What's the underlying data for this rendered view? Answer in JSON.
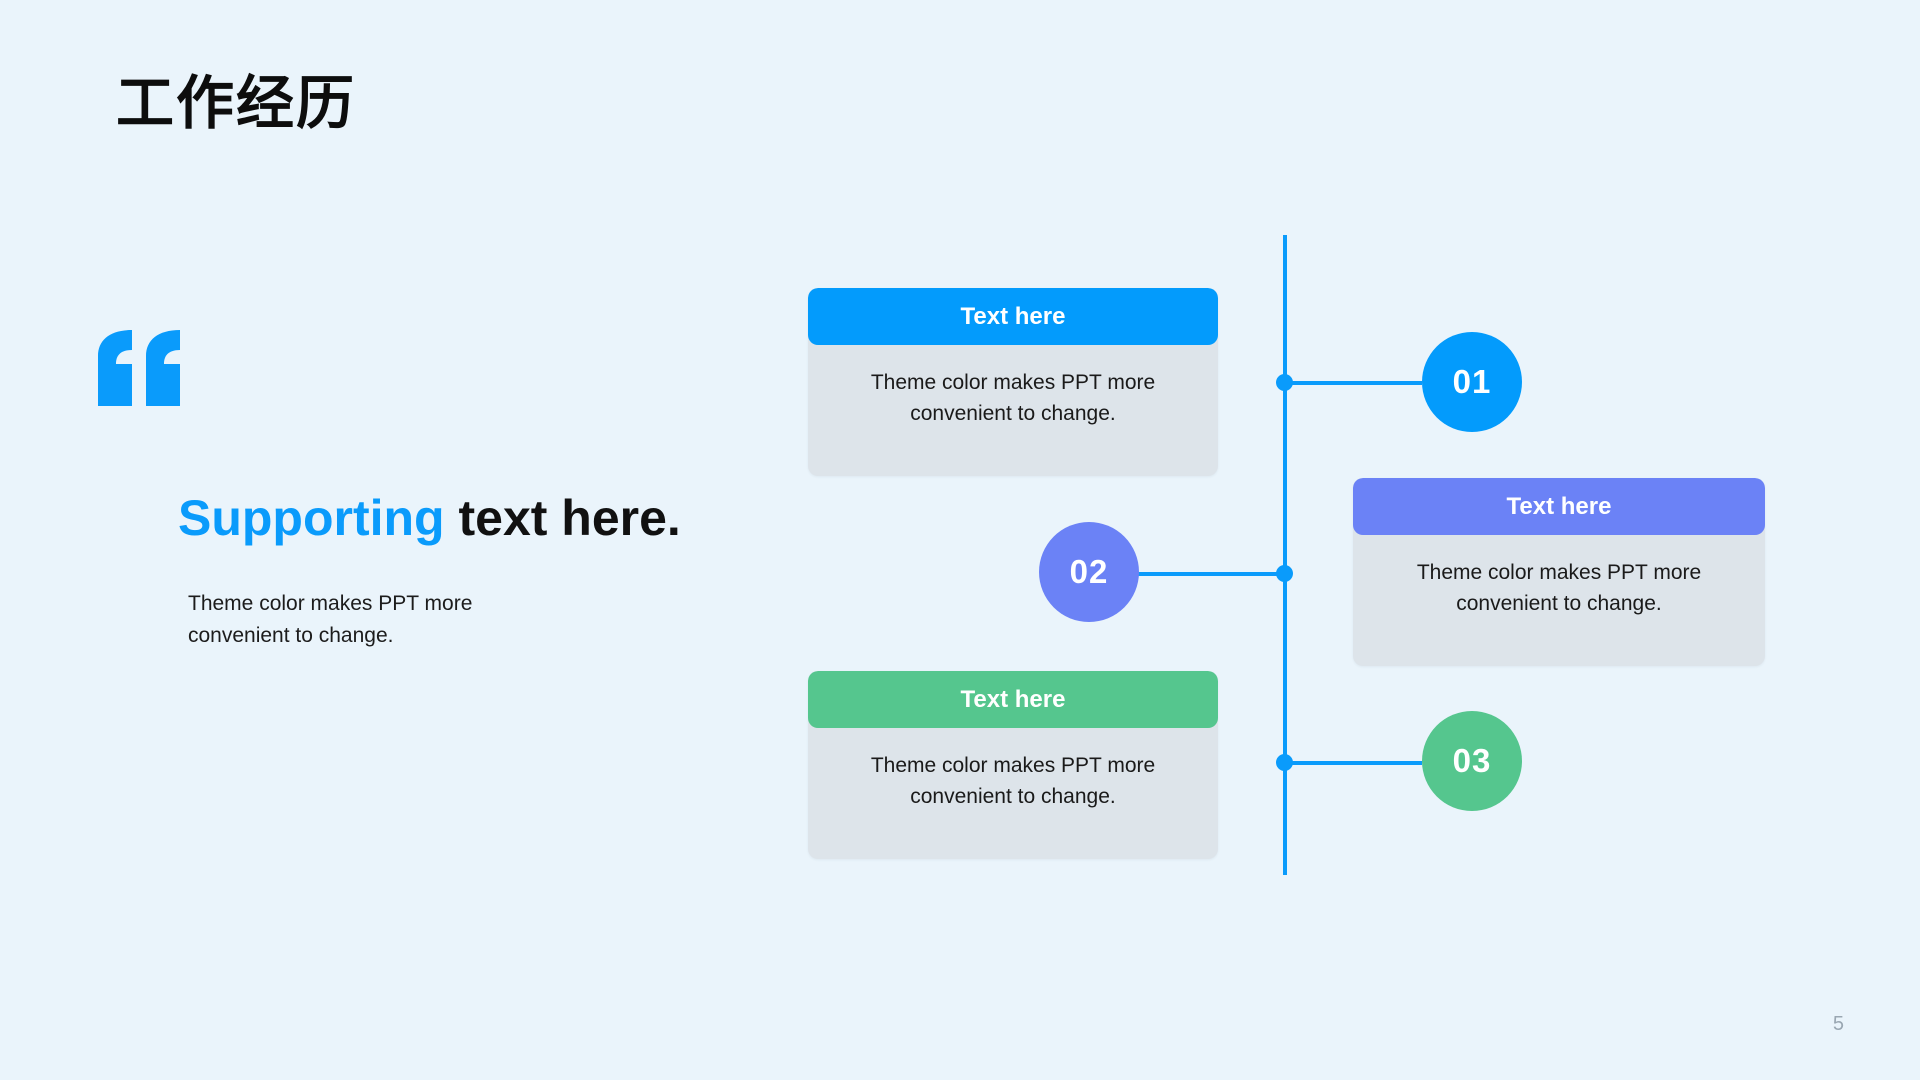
{
  "slide": {
    "title": "工作经历",
    "page_number": "5",
    "background_color": "#eaf4fb"
  },
  "left_block": {
    "quote_icon": "quote-mark-icon",
    "heading_accent": "Supporting",
    "heading_rest": " text here.",
    "paragraph": "Theme color makes PPT more convenient to change.",
    "accent_color": "#0a9bfb"
  },
  "timeline": {
    "axis_color": "#0a9bfb",
    "markers": [
      {
        "number": "01",
        "color": "#039bfc"
      },
      {
        "number": "02",
        "color": "#6b82f6"
      },
      {
        "number": "03",
        "color": "#55c68e"
      }
    ]
  },
  "cards": [
    {
      "header": "Text here",
      "body": "Theme color makes PPT more convenient to change.",
      "header_color": "#039bfc",
      "body_color": "#dde4ea"
    },
    {
      "header": "Text here",
      "body": "Theme color makes PPT more convenient to change.",
      "header_color": "#6b82f6",
      "body_color": "#dde4ea"
    },
    {
      "header": "Text here",
      "body": "Theme color makes PPT more convenient to change.",
      "header_color": "#55c68e",
      "body_color": "#dde4ea"
    }
  ]
}
